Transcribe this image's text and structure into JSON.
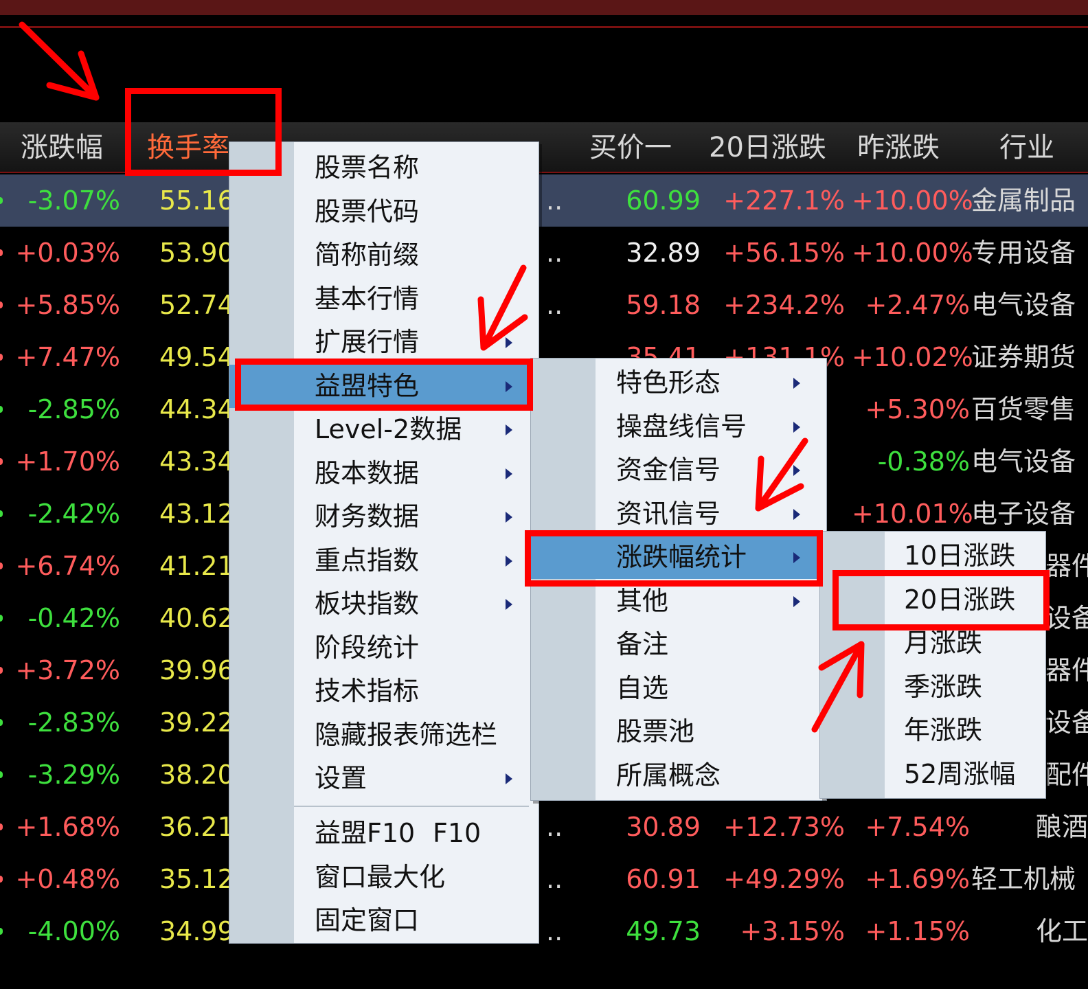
{
  "header": {
    "columns": [
      {
        "label": "涨跌幅",
        "active": false
      },
      {
        "label": "换手率",
        "active": true
      },
      {
        "label": "买价一",
        "active": false
      },
      {
        "label": "20日涨跌",
        "active": false
      },
      {
        "label": "昨涨跌",
        "active": false
      },
      {
        "label": "行业",
        "active": false
      }
    ]
  },
  "rows": [
    {
      "change": "-3.07%",
      "turnover": "55.16",
      "bid": "60.99",
      "d20": "+227.1%",
      "yest": "+10.00%",
      "industry": "金属制品"
    },
    {
      "change": "+0.03%",
      "turnover": "53.90",
      "bid": "32.89",
      "d20": "+56.15%",
      "yest": "+10.00%",
      "industry": "专用设备"
    },
    {
      "change": "+5.85%",
      "turnover": "52.74",
      "bid": "59.18",
      "d20": "+234.2%",
      "yest": "+2.47%",
      "industry": "电气设备"
    },
    {
      "change": "+7.47%",
      "turnover": "49.54",
      "bid": "35.41",
      "d20": "+131.1%",
      "yest": "+10.02%",
      "industry": "证券期货"
    },
    {
      "change": "-2.85%",
      "turnover": "44.34",
      "bid": "",
      "d20": "",
      "yest": "+5.30%",
      "industry": "百货零售"
    },
    {
      "change": "+1.70%",
      "turnover": "43.34",
      "bid": "",
      "d20": "",
      "yest": "-0.38%",
      "industry": "电气设备"
    },
    {
      "change": "-2.42%",
      "turnover": "43.12",
      "bid": "",
      "d20": "",
      "yest": "+10.01%",
      "industry": "电子设备"
    },
    {
      "change": "+6.74%",
      "turnover": "41.21",
      "bid": "",
      "d20": "",
      "yest": "",
      "industry": "器件"
    },
    {
      "change": "-0.42%",
      "turnover": "40.62",
      "bid": "",
      "d20": "",
      "yest": "",
      "industry": "设备"
    },
    {
      "change": "+3.72%",
      "turnover": "39.96",
      "bid": "",
      "d20": "",
      "yest": "",
      "industry": "器件"
    },
    {
      "change": "-2.83%",
      "turnover": "39.22",
      "bid": "",
      "d20": "",
      "yest": "",
      "industry": "设备"
    },
    {
      "change": "-3.29%",
      "turnover": "38.20",
      "bid": "",
      "d20": "",
      "yest": "",
      "industry": "配件"
    },
    {
      "change": "+1.68%",
      "turnover": "36.21",
      "bid": "30.89",
      "d20": "+12.73%",
      "yest": "+7.54%",
      "industry": "酿酒"
    },
    {
      "change": "+0.48%",
      "turnover": "35.12",
      "bid": "60.91",
      "d20": "+49.29%",
      "yest": "+1.69%",
      "industry": "轻工机械"
    },
    {
      "change": "-4.00%",
      "turnover": "34.99",
      "bid": "49.73",
      "d20": "+3.15%",
      "yest": "+1.15%",
      "industry": "化工"
    }
  ],
  "menu1": {
    "items": [
      {
        "label": "股票名称",
        "submenu": false
      },
      {
        "label": "股票代码",
        "submenu": false
      },
      {
        "label": "简称前缀",
        "submenu": false
      },
      {
        "label": "基本行情",
        "submenu": false
      },
      {
        "label": "扩展行情",
        "submenu": true
      },
      {
        "label": "益盟特色",
        "submenu": true,
        "highlighted": true
      },
      {
        "label": "Level-2数据",
        "submenu": true
      },
      {
        "label": "股本数据",
        "submenu": true
      },
      {
        "label": "财务数据",
        "submenu": true
      },
      {
        "label": "重点指数",
        "submenu": true
      },
      {
        "label": "板块指数",
        "submenu": true
      },
      {
        "label": "阶段统计",
        "submenu": false
      },
      {
        "label": "技术指标",
        "submenu": false
      },
      {
        "label": "隐藏报表筛选栏",
        "submenu": false
      },
      {
        "label": "设置",
        "submenu": true
      }
    ],
    "bottom_items": [
      {
        "label": "益盟F10",
        "shortcut": "F10"
      },
      {
        "label": "窗口最大化",
        "shortcut": ""
      },
      {
        "label": "固定窗口",
        "shortcut": ""
      }
    ]
  },
  "menu2": {
    "items": [
      {
        "label": "特色形态",
        "submenu": true
      },
      {
        "label": "操盘线信号",
        "submenu": true
      },
      {
        "label": "资金信号",
        "submenu": true
      },
      {
        "label": "资讯信号",
        "submenu": true
      },
      {
        "label": "涨跌幅统计",
        "submenu": true,
        "highlighted": true
      },
      {
        "label": "其他",
        "submenu": true
      },
      {
        "label": "备注",
        "submenu": false
      },
      {
        "label": "自选",
        "submenu": false
      },
      {
        "label": "股票池",
        "submenu": false
      },
      {
        "label": "所属概念",
        "submenu": false
      }
    ]
  },
  "menu3": {
    "items": [
      {
        "label": "10日涨跌"
      },
      {
        "label": "20日涨跌",
        "boxed": true
      },
      {
        "label": "月涨跌"
      },
      {
        "label": "季涨跌"
      },
      {
        "label": "年涨跌"
      },
      {
        "label": "52周涨幅"
      }
    ]
  },
  "colors": {
    "up": "#ff5c5c",
    "down": "#3ee03e",
    "turnover": "#e8e84a",
    "menu_highlight": "#5a9bcf",
    "annotation": "#ff0000"
  }
}
